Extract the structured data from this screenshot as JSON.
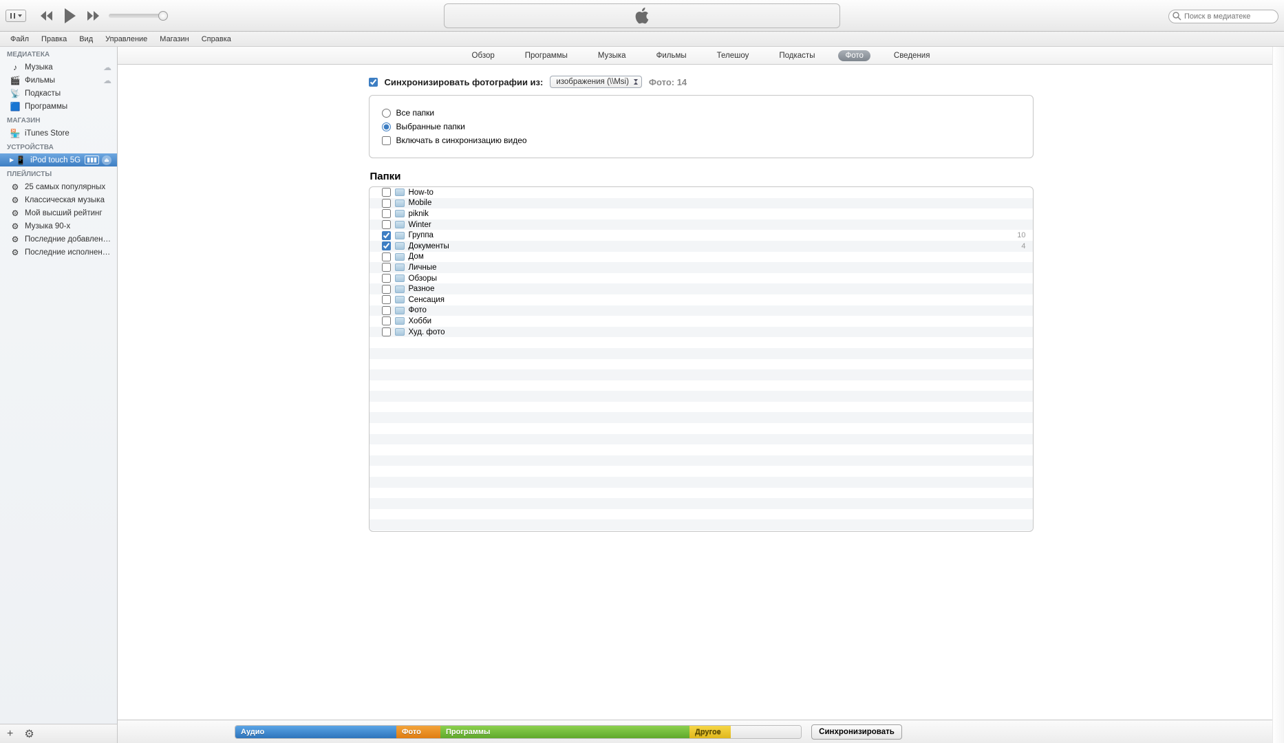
{
  "window": {
    "minimize": "–",
    "maximize": "☐",
    "close": "✕"
  },
  "toolbar": {
    "search_placeholder": "Поиск в медиатеке"
  },
  "menu": [
    "Файл",
    "Правка",
    "Вид",
    "Управление",
    "Магазин",
    "Справка"
  ],
  "sidebar": {
    "sections": [
      {
        "title": "МЕДИАТЕКА",
        "items": [
          {
            "icon": "♪",
            "label": "Музыка",
            "cloud": true
          },
          {
            "icon": "🎬",
            "label": "Фильмы",
            "cloud": true
          },
          {
            "icon": "📡",
            "label": "Подкасты"
          },
          {
            "icon": "🟦",
            "label": "Программы"
          }
        ]
      },
      {
        "title": "МАГАЗИН",
        "items": [
          {
            "icon": "🏪",
            "label": "iTunes Store"
          }
        ]
      },
      {
        "title": "УСТРОЙСТВА",
        "items": [
          {
            "icon": "📱",
            "label": "iPod touch 5G",
            "selected": true,
            "device": true
          }
        ]
      },
      {
        "title": "ПЛЕЙЛИСТЫ",
        "items": [
          {
            "icon": "⚙",
            "label": "25 самых популярных"
          },
          {
            "icon": "⚙",
            "label": "Классическая музыка"
          },
          {
            "icon": "⚙",
            "label": "Мой высший рейтинг"
          },
          {
            "icon": "⚙",
            "label": "Музыка 90-х"
          },
          {
            "icon": "⚙",
            "label": "Последние добавленные"
          },
          {
            "icon": "⚙",
            "label": "Последние исполненные"
          }
        ]
      }
    ],
    "footer": {
      "add": "+",
      "gear": "⚙"
    }
  },
  "tabs": [
    "Обзор",
    "Программы",
    "Музыка",
    "Фильмы",
    "Телешоу",
    "Подкасты",
    "Фото",
    "Сведения"
  ],
  "active_tab": "Фото",
  "sync": {
    "checkbox_label": "Синхронизировать фотографии из:",
    "source": "изображения (\\\\Msi)",
    "count_label": "Фото: 14",
    "opt_all": "Все папки",
    "opt_selected": "Выбранные папки",
    "opt_video": "Включать в синхронизацию видео"
  },
  "folders_title": "Папки",
  "folders": [
    {
      "name": "How-to",
      "checked": false
    },
    {
      "name": "Mobile",
      "checked": false
    },
    {
      "name": "piknik",
      "checked": false
    },
    {
      "name": "Winter",
      "checked": false
    },
    {
      "name": "Группа",
      "checked": true,
      "count": "10"
    },
    {
      "name": "Документы",
      "checked": true,
      "count": "4"
    },
    {
      "name": "Дом",
      "checked": false
    },
    {
      "name": "Личные",
      "checked": false
    },
    {
      "name": "Обзоры",
      "checked": false
    },
    {
      "name": "Разное",
      "checked": false
    },
    {
      "name": "Сенсация",
      "checked": false
    },
    {
      "name": "Фото",
      "checked": false
    },
    {
      "name": "Хобби",
      "checked": false
    },
    {
      "name": "Худ. фото",
      "checked": false
    }
  ],
  "capacity": {
    "audio": "Аудио",
    "photo": "Фото",
    "apps": "Программы",
    "other": "Другое"
  },
  "sync_button": "Синхронизировать"
}
